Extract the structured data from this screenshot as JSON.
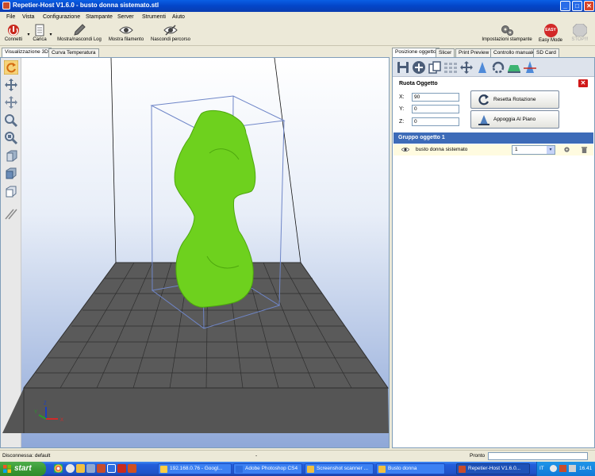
{
  "window": {
    "title": "Repetier-Host V1.6.0 - busto donna sistemato.stl",
    "buttons": {
      "minimize": "_",
      "maximize": "□",
      "close": "✕"
    }
  },
  "menu": [
    "File",
    "Vista",
    "Configurazione",
    "Stampante",
    "Server",
    "Strumenti",
    "Aiuto"
  ],
  "toolbar": {
    "connect": "Connetti",
    "load": "Carica",
    "toggle_log": "Mostra/nascondi Log",
    "show_filament": "Mostra filamento",
    "hide_path": "Nascondi percorso",
    "printer_settings": "Impostazioni stampante",
    "easy_mode": "Easy Mode",
    "easy_badge": "EASY",
    "stop": "STOP!!!"
  },
  "left_tabs": [
    "Visualizzazione 3D",
    "Curva Temperatura"
  ],
  "right_tabs": [
    "Posizione oggetto",
    "Slicer",
    "Print Preview",
    "Controllo manuale",
    "SD Card"
  ],
  "rotate": {
    "title": "Ruota Oggetto",
    "close": "✕",
    "x_label": "X:",
    "x_value": "90",
    "y_label": "Y:",
    "y_value": "0",
    "z_label": "Z:",
    "z_value": "0",
    "reset_button": "Resetta Rotazione",
    "land_button": "Appoggia Al Piano"
  },
  "group": {
    "header": "Gruppo oggetto 1",
    "object_name": "busto donna sistemato",
    "copies": "1"
  },
  "status": {
    "connection": "Disconnessa: default",
    "middle": "-",
    "ready": "Pronto"
  },
  "axes": {
    "x": "X",
    "y": "Y",
    "z": "Z"
  },
  "taskbar": {
    "start": "start",
    "tasks": [
      "192.168.0.76 - Googl...",
      "Adobe Photoshop CS4",
      "Screenshot scanner ...",
      "Busto donna",
      "Repetier-Host V1.6.0..."
    ],
    "lang": "IT",
    "time": "16.41"
  },
  "colors": {
    "model": "#6ed11e",
    "bed": "#555555",
    "accent": "#3d6bb8"
  }
}
